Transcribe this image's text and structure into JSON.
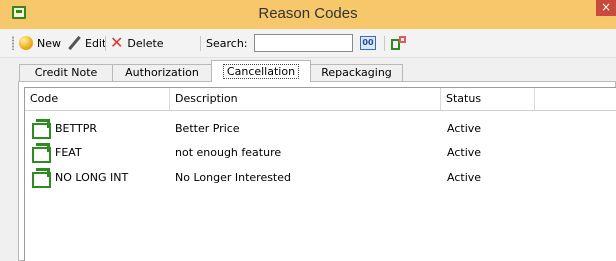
{
  "window": {
    "title": "Reason Codes",
    "close_glyph": "×"
  },
  "toolbar": {
    "new_label": "New",
    "edit_label": "Edit",
    "delete_label": "Delete",
    "search_label": "Search:",
    "search_value": "",
    "find_glyph": "00"
  },
  "tabs": [
    {
      "label": "Credit Note"
    },
    {
      "label": "Authorization"
    },
    {
      "label": "Cancellation"
    },
    {
      "label": "Repackaging"
    }
  ],
  "active_tab": "Cancellation",
  "grid": {
    "columns": [
      "Code",
      "Description",
      "Status"
    ],
    "rows": [
      {
        "code": "BETTPR",
        "description": "Better Price",
        "status": "Active"
      },
      {
        "code": "FEAT",
        "description": "not enough feature",
        "status": "Active"
      },
      {
        "code": "NO LONG INT",
        "description": "No Longer Interested",
        "status": "Active"
      }
    ]
  },
  "colors": {
    "title_bar": "#f7c86b",
    "close_button": "#c74a3c",
    "row_icon_green": "#2e8b1f"
  },
  "icons": {
    "title": "window-app-icon",
    "new": "new-orb-icon",
    "edit": "pencil-icon",
    "delete": "red-x-icon",
    "find": "binoculars-icon",
    "export": "export-icon",
    "row": "green-record-icon"
  }
}
